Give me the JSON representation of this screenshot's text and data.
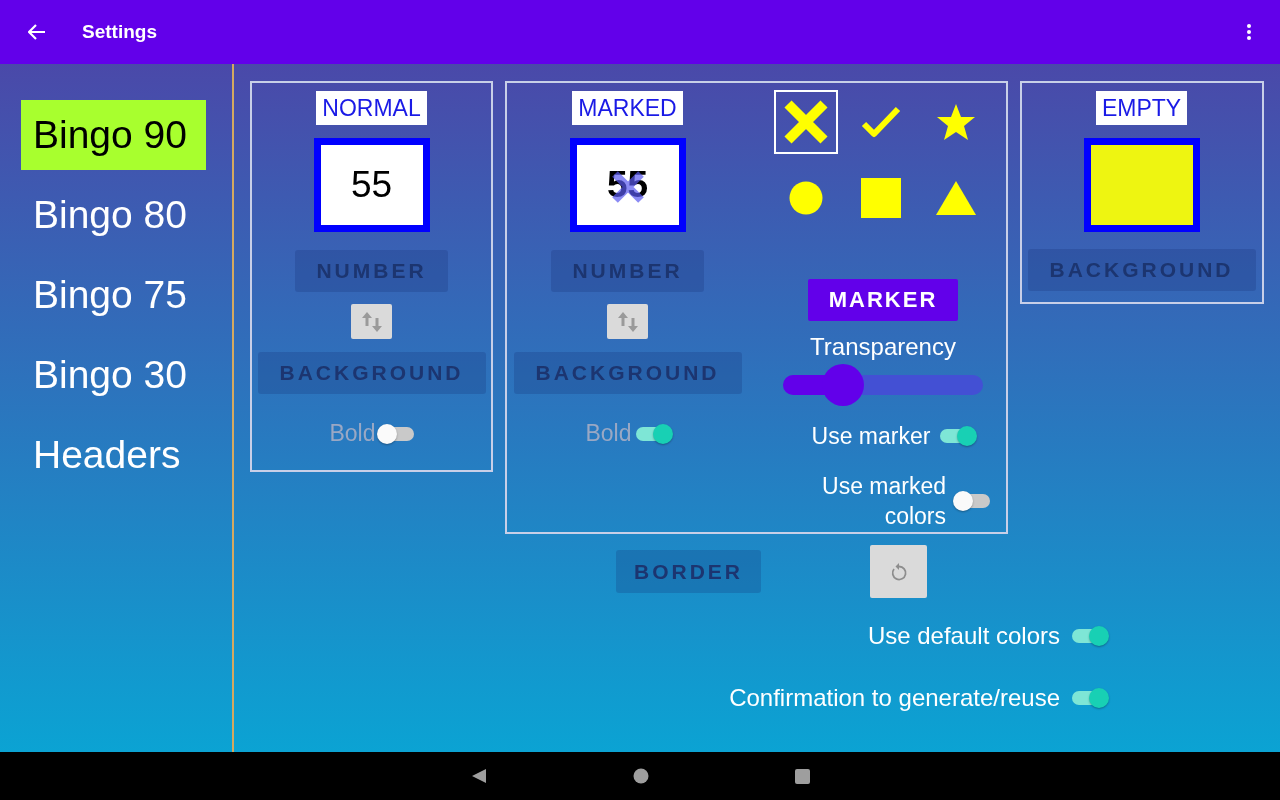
{
  "app_bar": {
    "title": "Settings"
  },
  "sidebar": {
    "items": [
      {
        "label": "Bingo 90",
        "selected": true
      },
      {
        "label": "Bingo 80",
        "selected": false
      },
      {
        "label": "Bingo 75",
        "selected": false
      },
      {
        "label": "Bingo 30",
        "selected": false
      },
      {
        "label": "Headers",
        "selected": false
      }
    ]
  },
  "normal": {
    "label": "NORMAL",
    "sample": "55",
    "number_button": {
      "label": "NUMBER",
      "disabled": true
    },
    "background_button": {
      "label": "BACKGROUND",
      "disabled": true
    },
    "bold": {
      "label": "Bold",
      "on": false
    }
  },
  "marked": {
    "label": "MARKED",
    "sample": "55",
    "number_button": {
      "label": "NUMBER",
      "disabled": true
    },
    "background_button": {
      "label": "BACKGROUND",
      "disabled": true
    },
    "bold": {
      "label": "Bold",
      "on": true
    },
    "shapes": [
      {
        "kind": "cross",
        "selected": true
      },
      {
        "kind": "check",
        "selected": false
      },
      {
        "kind": "star",
        "selected": false
      },
      {
        "kind": "circle",
        "selected": false
      },
      {
        "kind": "square",
        "selected": false
      },
      {
        "kind": "triangle",
        "selected": false
      }
    ],
    "marker_button": "MARKER",
    "transparency": {
      "label": "Transparency",
      "level": 0.3
    },
    "toggles": [
      {
        "label": "Use marker",
        "on": true
      },
      {
        "label": "Use marked colors",
        "on": false
      }
    ]
  },
  "empty": {
    "label": "EMPTY",
    "background_button": {
      "label": "BACKGROUND",
      "disabled": true
    }
  },
  "border_button": {
    "label": "BORDER",
    "disabled": true
  },
  "toggles": [
    {
      "label": "Use default colors",
      "on": true
    },
    {
      "label": "Confirmation to generate/reuse",
      "on": true
    }
  ]
}
